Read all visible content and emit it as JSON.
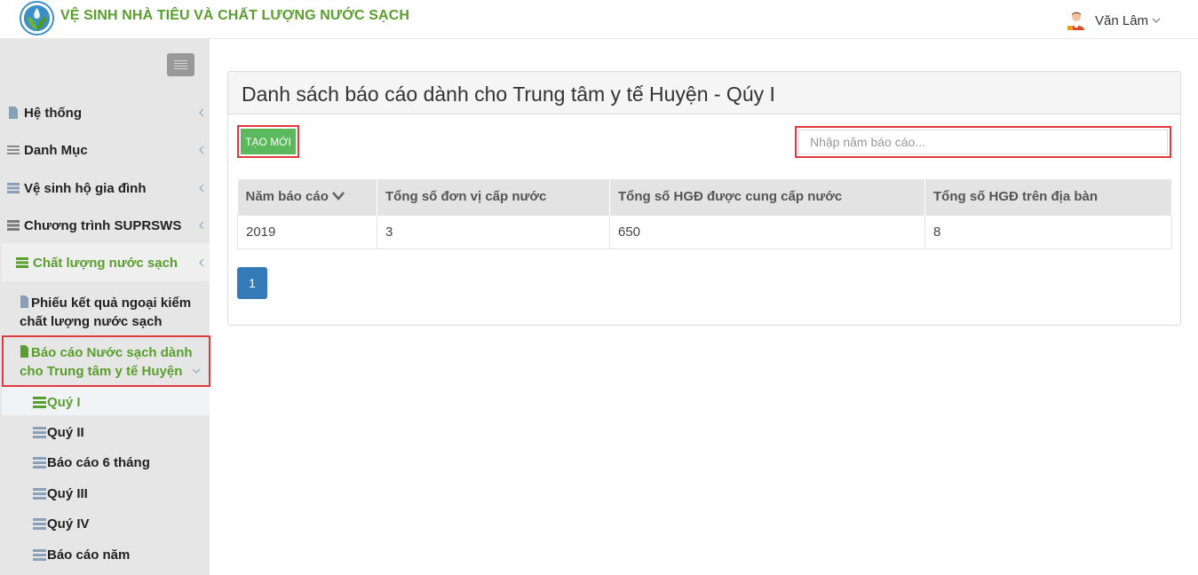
{
  "header": {
    "app_title": "VỆ SINH NHÀ TIÊU VÀ CHẤT LƯỢNG NƯỚC SẠCH",
    "user_name": "Văn Lâm",
    "brand_color": "#5a9e2e"
  },
  "sidebar": {
    "items": [
      {
        "label": "Hệ thống",
        "icon": "file-icon"
      },
      {
        "label": "Danh Mục",
        "icon": "list-icon"
      },
      {
        "label": "Vệ sinh hộ gia đình",
        "icon": "server-icon"
      },
      {
        "label": "Chương trình SUPRSWS",
        "icon": "server-icon"
      },
      {
        "label": "Chất lượng nước sạch",
        "icon": "server-icon"
      }
    ],
    "sub_items": [
      {
        "label": "Phiếu kết quả ngoại kiểm chất lượng nước sạch"
      },
      {
        "label": "Báo cáo Nước sạch dành cho Trung tâm y tế Huyện"
      }
    ],
    "leaves": [
      {
        "label": "Quý I"
      },
      {
        "label": "Quý II"
      },
      {
        "label": "Báo cáo 6 tháng"
      },
      {
        "label": "Quý III"
      },
      {
        "label": "Quý IV"
      },
      {
        "label": "Báo cáo năm"
      }
    ]
  },
  "main": {
    "title": "Danh sách báo cáo dành cho Trung tâm y tế Huyện - Qúy I",
    "new_button_label": "TẠO MỚI",
    "search_placeholder": "Nhập năm báo cáo...",
    "table": {
      "columns": [
        "Năm báo cáo",
        "Tổng số đơn vị cấp nước",
        "Tổng số HGĐ được cung cấp nước",
        "Tổng số HGĐ trên địa bàn"
      ],
      "rows": [
        [
          "2019",
          "3",
          "650",
          "8"
        ]
      ]
    },
    "pagination": {
      "current_page": "1"
    }
  },
  "colors": {
    "accent_green": "#5cb85c",
    "highlight_red": "#e0393e",
    "pagination_blue": "#337ab7"
  }
}
